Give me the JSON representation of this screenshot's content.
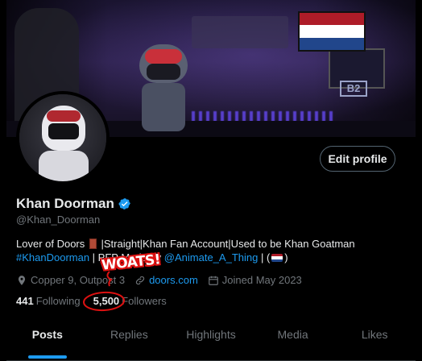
{
  "profile": {
    "display_name": "Khan Doorman",
    "handle": "@Khan_Doorman",
    "edit_label": "Edit profile",
    "bio": {
      "part1": "Lover of Doors",
      "part2": " |Straight|Khan Fan Account|Used to be Khan Goatman",
      "hashtag": "#KhanDoorman",
      "mid": " | PFP Made by ",
      "mention": "@Animate_A_Thing",
      "end_open": " | (",
      "end_close": ")"
    },
    "location": "Copper 9, Outpost 3",
    "website": "doors.com",
    "joined": "Joined May 2023",
    "following_count": "441",
    "following_label": "Following",
    "followers_count": "5,500",
    "followers_label": "Followers"
  },
  "annotation": {
    "text": "WOATS!"
  },
  "tabs": [
    {
      "label": "Posts"
    },
    {
      "label": "Replies"
    },
    {
      "label": "Highlights"
    },
    {
      "label": "Media"
    },
    {
      "label": "Likes"
    }
  ],
  "banner": {
    "sign": "B2"
  },
  "colors": {
    "accent": "#1d9bf0",
    "muted": "#71767b",
    "annotation_red": "#dd1111",
    "flag_red": "#ae1c28",
    "flag_blue": "#21468b"
  },
  "icons": [
    "verified-badge-icon",
    "door-emoji-icon",
    "location-icon",
    "link-icon",
    "calendar-icon",
    "netherlands-flag-icon"
  ]
}
